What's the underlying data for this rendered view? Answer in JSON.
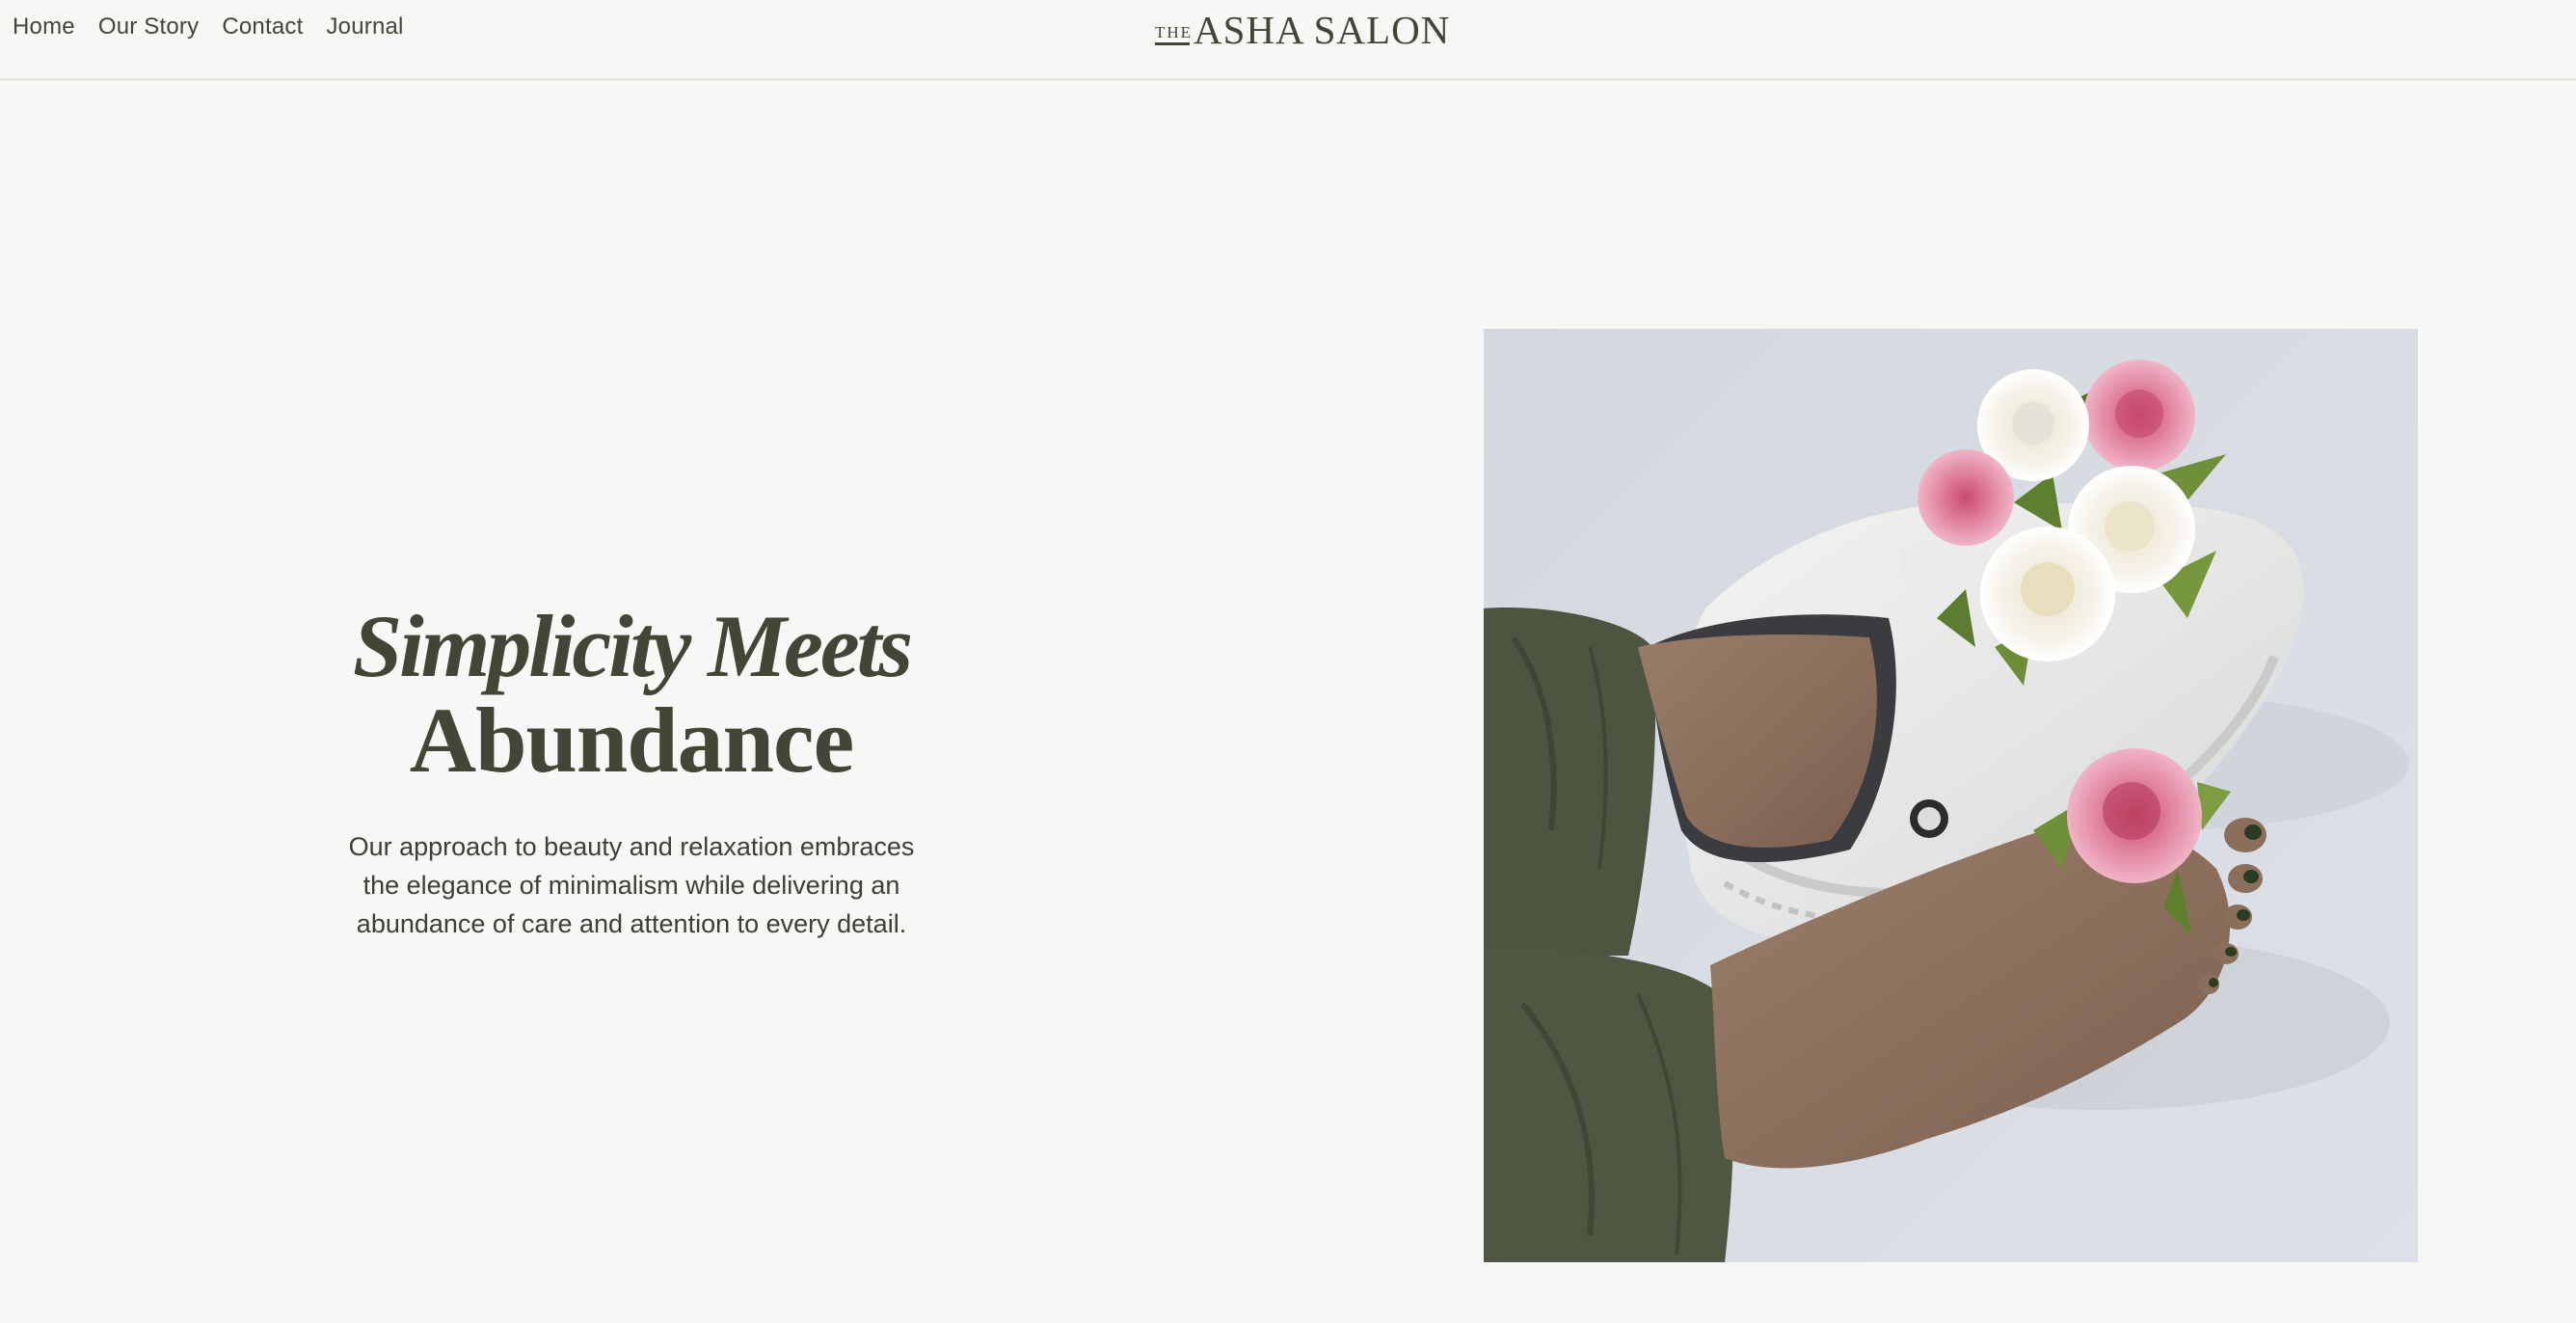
{
  "nav": {
    "items": [
      {
        "label": "Home"
      },
      {
        "label": "Our Story"
      },
      {
        "label": "Contact"
      },
      {
        "label": "Journal"
      }
    ]
  },
  "logo": {
    "the": "THE",
    "name": "ASHA SALON"
  },
  "hero": {
    "headline_line1": "Simplicity Meets",
    "headline_line2": "Abundance",
    "description": "Our approach to beauty and relaxation embraces the elegance of minimalism while delivering an abundance of care and attention to every detail."
  },
  "colors": {
    "background": "#f7f7f6",
    "text": "#444536",
    "divider": "#e6e6e3"
  }
}
